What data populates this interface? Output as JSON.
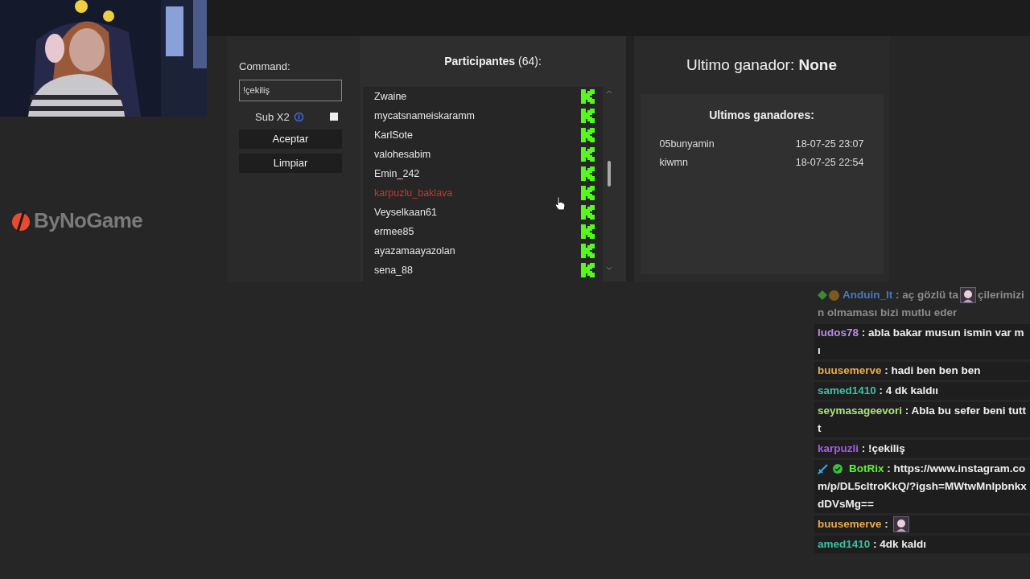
{
  "logo": {
    "text": "ByNoGame"
  },
  "command": {
    "label": "Command:",
    "value": "!çekiliş"
  },
  "sub_x2": {
    "label": "Sub X2",
    "checked": false
  },
  "buttons": [
    "Aceptar",
    "Limpiar"
  ],
  "participants": {
    "title": "Participantes",
    "count": "(64):",
    "items": [
      {
        "name": "Zwaine",
        "color": "#e6e6e6"
      },
      {
        "name": "mycatsnameiskaramm",
        "color": "#e6e6e6"
      },
      {
        "name": "KarlSote",
        "color": "#e6e6e6"
      },
      {
        "name": "valohesabim",
        "color": "#e6e6e6"
      },
      {
        "name": "Emin_242",
        "color": "#e6e6e6"
      },
      {
        "name": "karpuzlu_baklava",
        "color": "#c03a32"
      },
      {
        "name": "Veyselkaan61",
        "color": "#e6e6e6"
      },
      {
        "name": "ermee85",
        "color": "#e6e6e6"
      },
      {
        "name": "ayazamaayazolan",
        "color": "#e6e6e6"
      },
      {
        "name": "sena_88",
        "color": "#e6e6e6"
      }
    ]
  },
  "last_winner": {
    "label": "Ultimo ganador:",
    "value": "None"
  },
  "winners": {
    "title": "Ultimos ganadores:",
    "rows": [
      {
        "name": "05bunyamin",
        "time": "18-07-25 23:07"
      },
      {
        "name": "kiwmn",
        "time": "18-07-25 22:54"
      }
    ]
  },
  "chat": [
    {
      "kind": "sub",
      "user": "Anduin_lt",
      "color": "#4a78c0",
      "faded": true,
      "sep": ":",
      "parts": [
        {
          "kind": "text",
          "text": "aç gözlü ta"
        },
        {
          "kind": "emote"
        },
        {
          "kind": "text",
          "text": "çilerimizin olmaması bizi mutlu eder"
        }
      ]
    },
    {
      "kind": "plain",
      "user": "ludos78",
      "color": "#b48ee8",
      "faded": false,
      "sep": ":",
      "parts": [
        {
          "kind": "text",
          "text": "abla bakar musun ismin var mı"
        }
      ]
    },
    {
      "kind": "plain",
      "user": "buusemerve",
      "color": "#e8aa50",
      "faded": false,
      "sep": ":",
      "parts": [
        {
          "kind": "text",
          "text": "hadi ben ben ben"
        }
      ]
    },
    {
      "kind": "plain",
      "user": "samed1410",
      "color": "#3cc0a2",
      "faded": false,
      "sep": ":",
      "parts": [
        {
          "kind": "text",
          "text": "4 dk kaldıı"
        }
      ]
    },
    {
      "kind": "plain",
      "user": "seymasageevori",
      "color": "#a8e27c",
      "faded": false,
      "sep": ":",
      "parts": [
        {
          "kind": "text",
          "text": "Abla bu sefer beni tuttt"
        }
      ]
    },
    {
      "kind": "plain",
      "user": "karpuzli",
      "color": "#a45ee6",
      "faded": false,
      "sep": ":",
      "parts": [
        {
          "kind": "text",
          "text": "!çekiliş"
        }
      ]
    },
    {
      "kind": "bot",
      "user": "BotRix",
      "color": "#5ef03a",
      "faded": false,
      "sep": ":",
      "parts": [
        {
          "kind": "text",
          "text": "https://www.instagram.com/p/DL5cltroKkQ/?igsh=MWtwMnlpbnkxdDVsMg=="
        }
      ]
    },
    {
      "kind": "plain",
      "user": "buusemerve",
      "color": "#e8aa50",
      "faded": false,
      "sep": ":",
      "parts": [
        {
          "kind": "emote"
        }
      ]
    },
    {
      "kind": "plain",
      "user": "amed1410",
      "color": "#3cc0a2",
      "faded": false,
      "sep": ":",
      "parts": [
        {
          "kind": "text",
          "text": "4dk kaldı"
        }
      ]
    }
  ]
}
